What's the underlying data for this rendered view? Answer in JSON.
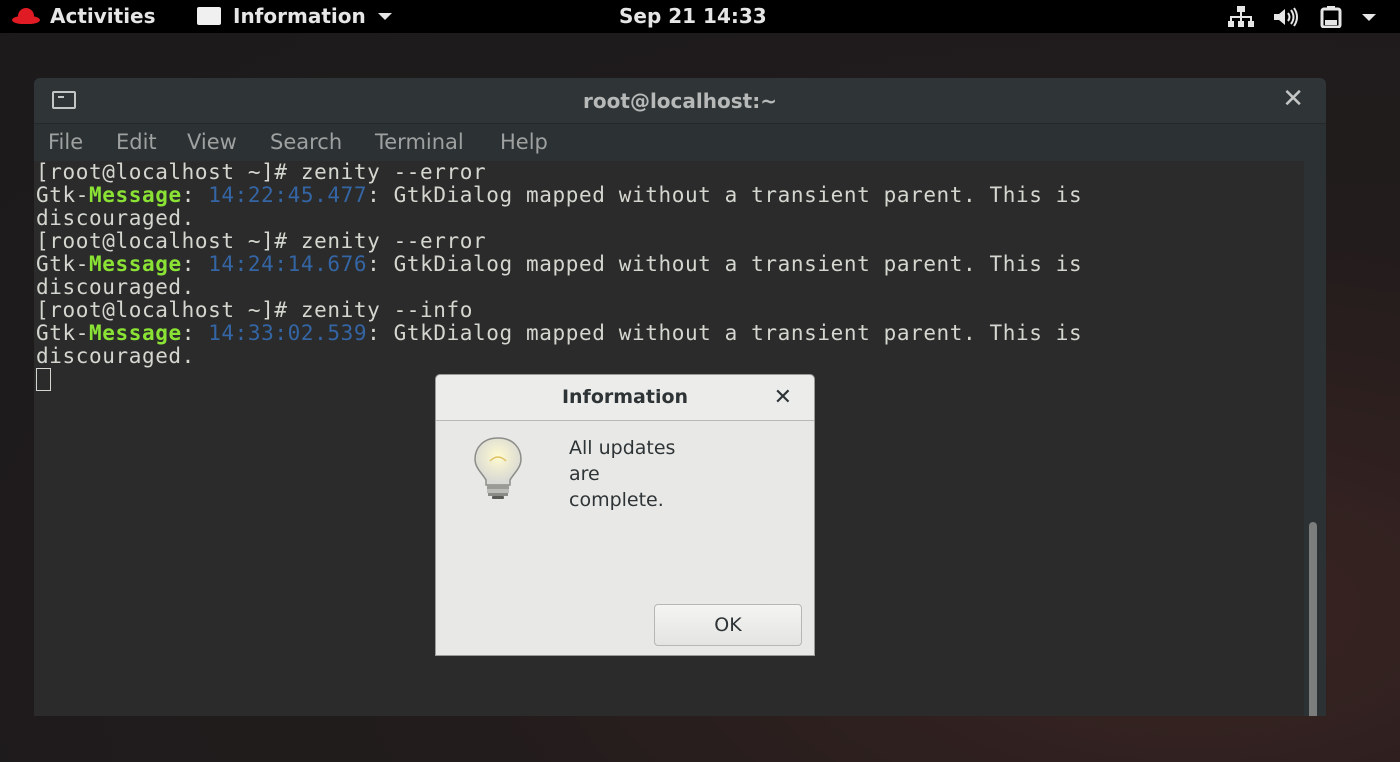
{
  "topbar": {
    "activities": "Activities",
    "app_name": "Information",
    "clock": "Sep 21  14:33",
    "icons": [
      "network-icon",
      "volume-icon",
      "battery-icon",
      "system-menu-caret-icon"
    ]
  },
  "terminal": {
    "title": "root@localhost:~",
    "menu": [
      "File",
      "Edit",
      "View",
      "Search",
      "Terminal",
      "Help"
    ],
    "lines": [
      {
        "kind": "prompt",
        "text": "[root@localhost ~]# zenity --error"
      },
      {
        "kind": "gtk",
        "prefix": "Gtk-",
        "tag": "Message",
        "sep1": ": ",
        "time": "14:22:45.477",
        "rest": ": GtkDialog mapped without a transient parent. This is"
      },
      {
        "kind": "plain",
        "text": "discouraged."
      },
      {
        "kind": "prompt",
        "text": "[root@localhost ~]# zenity --error"
      },
      {
        "kind": "gtk",
        "prefix": "Gtk-",
        "tag": "Message",
        "sep1": ": ",
        "time": "14:24:14.676",
        "rest": ": GtkDialog mapped without a transient parent. This is"
      },
      {
        "kind": "plain",
        "text": "discouraged."
      },
      {
        "kind": "prompt",
        "text": "[root@localhost ~]# zenity --info"
      },
      {
        "kind": "gtk",
        "prefix": "Gtk-",
        "tag": "Message",
        "sep1": ": ",
        "time": "14:33:02.539",
        "rest": ": GtkDialog mapped without a transient parent. This is"
      },
      {
        "kind": "plain",
        "text": "discouraged."
      }
    ],
    "colors": {
      "message": "#8ae234",
      "timestamp": "#3465a4",
      "text": "#d3d7cf",
      "background": "#2b2b2b"
    }
  },
  "dialog": {
    "title": "Information",
    "message_lines": [
      "All updates",
      "are",
      "complete."
    ],
    "ok_label": "OK",
    "icon": "lightbulb-icon"
  }
}
